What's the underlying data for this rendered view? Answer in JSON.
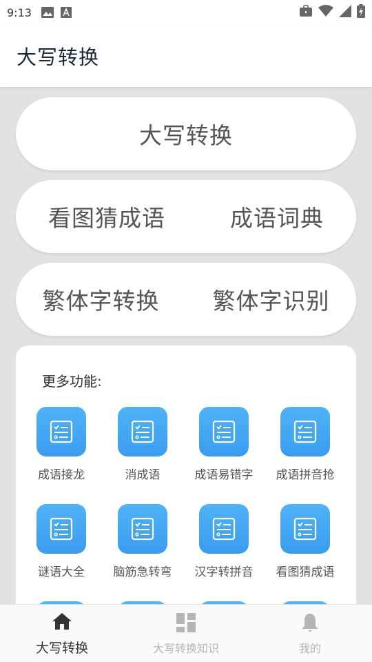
{
  "status_bar": {
    "time": "9:13",
    "left_icons": [
      "image-icon",
      "font-icon"
    ],
    "right_icons": [
      "briefcase-icon",
      "wifi-icon",
      "signal-icon",
      "battery-charging-icon"
    ]
  },
  "app_bar": {
    "title": "大写转换"
  },
  "feature_buttons": {
    "row1": [
      "大写转换"
    ],
    "row2": [
      "看图猜成语",
      "成语词典"
    ],
    "row3": [
      "繁体字转换",
      "繁体字识别"
    ]
  },
  "more": {
    "title": "更多功能:",
    "items": [
      {
        "label": "成语接龙",
        "icon": "checklist-icon"
      },
      {
        "label": "消成语",
        "icon": "checklist-icon"
      },
      {
        "label": "成语易错字",
        "icon": "checklist-icon"
      },
      {
        "label": "成语拼音抢",
        "icon": "checklist-icon"
      },
      {
        "label": "谜语大全",
        "icon": "checklist-icon"
      },
      {
        "label": "脑筋急转弯",
        "icon": "checklist-icon"
      },
      {
        "label": "汉字转拼音",
        "icon": "checklist-icon"
      },
      {
        "label": "看图猜成语",
        "icon": "checklist-icon"
      }
    ]
  },
  "bottom_nav": {
    "items": [
      {
        "label": "大写转换",
        "icon": "home-icon",
        "active": true
      },
      {
        "label": "大写转换知识",
        "icon": "dashboard-icon",
        "active": false
      },
      {
        "label": "我的",
        "icon": "bell-icon",
        "active": false
      }
    ]
  },
  "colors": {
    "accent": "#3a9cf0",
    "background": "#e2e2e2",
    "card": "#ffffff",
    "nav_inactive": "#b5b5b5"
  }
}
